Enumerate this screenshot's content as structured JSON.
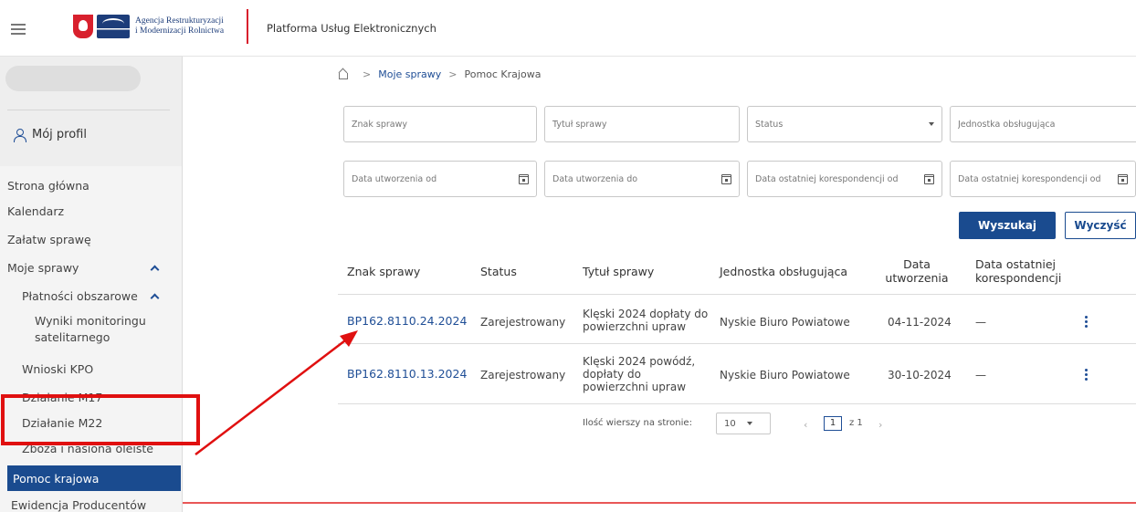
{
  "header": {
    "agency_line1": "Agencja Restrukturyzacji",
    "agency_line2": "i Modernizacji Rolnictwa",
    "platform_title": "Platforma Usług Elektronicznych"
  },
  "sidebar": {
    "profile": "Mój profil",
    "items": [
      "Strona główna",
      "Kalendarz",
      "Załatw sprawę",
      "Moje sprawy",
      "Płatności obszarowe",
      "Wyniki monitoringu satelitarnego",
      "Wnioski KPO",
      "Działanie M17",
      "Działanie M22",
      "Zboża i nasiona oleiste",
      "Pomoc krajowa",
      "Ewidencja Producentów"
    ]
  },
  "breadcrumb": {
    "items": [
      "Moje sprawy",
      "Pomoc Krajowa"
    ],
    "separator": ">"
  },
  "filters": {
    "case_number": "Znak sprawy",
    "case_title": "Tytuł sprawy",
    "status": "Status",
    "unit": "Jednostka obsługująca",
    "created_from": "Data utworzenia od",
    "created_to": "Data utworzenia do",
    "last_corr_from": "Data ostatniej korespondencji od",
    "last_corr_to": "Data ostatniej korespondencji od"
  },
  "actions": {
    "search": "Wyszukaj",
    "clear": "Wyczyść"
  },
  "table": {
    "headers": {
      "number": "Znak sprawy",
      "status": "Status",
      "title": "Tytuł sprawy",
      "unit": "Jednostka obsługująca",
      "created_line1": "Data",
      "created_line2": "utworzenia",
      "last_line1": "Data ostatniej",
      "last_line2": "korespondencji"
    },
    "rows": [
      {
        "number": "BP162.8110.24.2024",
        "status": "Zarejestrowany",
        "title_line1": "Klęski 2024 dopłaty do",
        "title_line2": "powierzchni upraw",
        "title_line3": "",
        "unit": "Nyskie Biuro Powiatowe",
        "created": "04-11-2024",
        "last": "—"
      },
      {
        "number": "BP162.8110.13.2024",
        "status": "Zarejestrowany",
        "title_line1": "Klęski 2024 powódź,",
        "title_line2": "dopłaty do",
        "title_line3": "powierzchni upraw",
        "unit": "Nyskie Biuro Powiatowe",
        "created": "30-10-2024",
        "last": "—"
      }
    ]
  },
  "pagination": {
    "rows_label": "Ilość wierszy na stronie:",
    "rows_value": "10",
    "page": "1",
    "of_label": "z 1"
  },
  "colors": {
    "primary": "#1a4b8f",
    "highlight": "#e01010"
  }
}
